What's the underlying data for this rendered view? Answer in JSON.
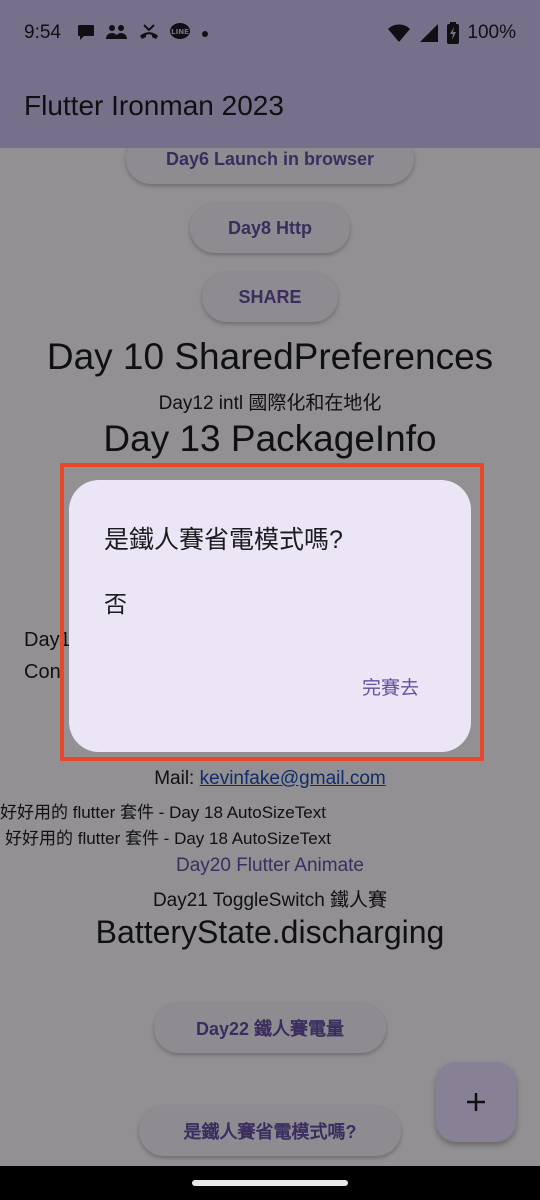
{
  "status_bar": {
    "time": "9:54",
    "battery": "100%",
    "icons": [
      "chat-bubble-icon",
      "people-icon",
      "missed-call-icon",
      "line-app-icon",
      "dot-icon",
      "wifi-icon",
      "signal-icon",
      "battery-icon"
    ]
  },
  "app_bar": {
    "title": "Flutter Ironman 2023"
  },
  "content": {
    "day6_button": "Day6 Launch in browser",
    "day8_button": "Day8 Http",
    "share_button": "SHARE",
    "day10_text": "Day 10 SharedPreferences",
    "day12_text": "Day12 intl 國際化和在地化",
    "day13_text": "Day 13 PackageInfo",
    "partial_day_text": "Day1",
    "partial_con_text": "Con",
    "mail_label": "Mail: ",
    "mail_link": "kevinfake@gmail.com",
    "autosize_text_1": "好好用的 flutter 套件 - Day 18 AutoSizeText",
    "autosize_text_2": "好好用的 flutter 套件 - Day 18 AutoSizeText",
    "day20_text": "Day20 Flutter Animate",
    "day21_text": "Day21 ToggleSwitch 鐵人賽",
    "battery_state_text": "BatteryState.discharging",
    "day22_button": "Day22 鐵人賽電量",
    "power_mode_button": "是鐵人賽省電模式嗎?"
  },
  "dialog": {
    "title": "是鐵人賽省電模式嗎?",
    "body": "否",
    "action": "完賽去"
  },
  "fab": {
    "icon": "plus-icon"
  },
  "colors": {
    "primary": "#6750a4",
    "app_bar": "#cdc1ef",
    "dialog_surface": "#ece5f5",
    "highlight": "#e8472b",
    "link": "#1a4fb3"
  }
}
